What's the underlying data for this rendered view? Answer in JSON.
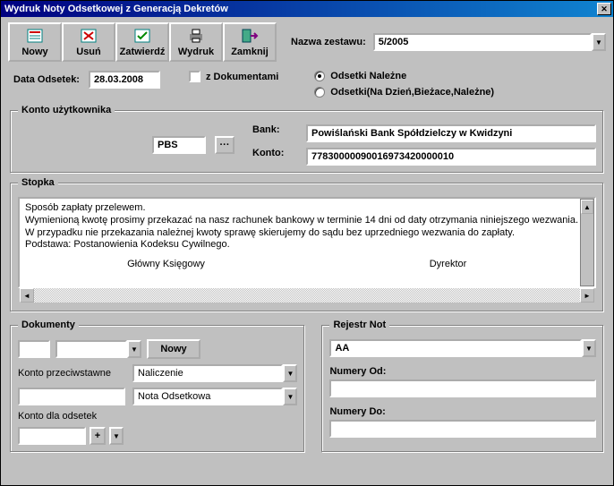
{
  "title": "Wydruk Noty Odsetkowej z Generacją Dekretów",
  "toolbar": {
    "nowy": "Nowy",
    "usun": "Usuń",
    "zatwierdz": "Zatwierdź",
    "wydruk": "Wydruk",
    "zamknij": "Zamknij"
  },
  "nazwa_zestawu_label": "Nazwa zestawu:",
  "nazwa_zestawu_value": "5/2005",
  "data_odsetek_label": "Data Odsetek:",
  "data_odsetek_value": "28.03.2008",
  "z_dokumentami_label": "z Dokumentami",
  "radio_nalezne": "Odsetki Należne",
  "radio_all": "Odsetki(Na Dzień,Bieżace,Należne)",
  "konto_uzytkownika": {
    "legend": "Konto użytkownika",
    "value": "PBS",
    "bank_label": "Bank:",
    "bank_value": "Powiślański Bank Spółdzielczy w Kwidzyni",
    "konto_label": "Konto:",
    "konto_value": "77830000090016973420000010"
  },
  "stopka": {
    "legend": "Stopka",
    "line1": "Sposób zapłaty przelewem.",
    "line2": "Wymienioną kwotę prosimy przekazać na nasz rachunek bankowy w terminie 14 dni od daty otrzymania niniejszego wezwania.",
    "line3": "W przypadku nie przekazania należnej kwoty  sprawę skierujemy do sądu bez uprzedniego wezwania do zapłaty.",
    "line4": "Podstawa: Postanowienia Kodeksu Cywilnego.",
    "sig_left": "Główny Księgowy",
    "sig_right": "Dyrektor"
  },
  "dokumenty": {
    "legend": "Dokumenty",
    "nowy_btn": "Nowy",
    "konto_przeciwstawne": "Konto przeciwstawne",
    "naliczenie": "Naliczenie",
    "nota": "Nota Odsetkowa",
    "konto_dla_odsetek": "Konto dla odsetek",
    "plus": "+"
  },
  "rejestr": {
    "legend": "Rejestr Not",
    "value": "AA",
    "numery_od": "Numery Od:",
    "numery_do": "Numery Do:"
  }
}
